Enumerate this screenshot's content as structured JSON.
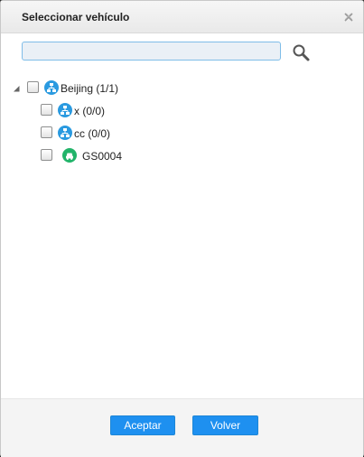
{
  "dialog": {
    "title": "Seleccionar vehículo",
    "close_icon": "close-icon"
  },
  "search": {
    "value": "",
    "placeholder": "",
    "icon": "search-icon"
  },
  "tree": {
    "root": {
      "label": "Beijing (1/1)",
      "expanded": true,
      "checked": false,
      "icon": "group-network-icon"
    },
    "children": [
      {
        "label": "x (0/0)",
        "checked": false,
        "icon": "group-network-icon"
      },
      {
        "label": "cc (0/0)",
        "checked": false,
        "icon": "group-network-icon"
      },
      {
        "label": "GS0004",
        "checked": false,
        "icon": "vehicle-online-icon"
      }
    ]
  },
  "footer": {
    "accept_label": "Aceptar",
    "back_label": "Volver"
  },
  "colors": {
    "primary_button": "#1e90f0",
    "group_icon": "#2a9ae0",
    "vehicle_online_icon": "#22b46a",
    "search_border": "#7fbde8"
  }
}
